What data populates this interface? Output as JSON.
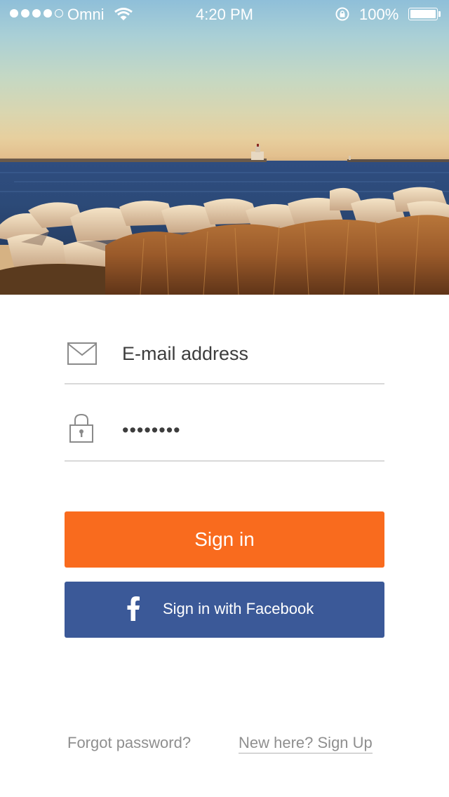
{
  "status_bar": {
    "carrier": "Omni",
    "time": "4:20 PM",
    "battery_percent": "100%",
    "signal_bars_filled": 4,
    "signal_bars_total": 5,
    "battery_level": 1.0
  },
  "hero": {
    "image_name": "lakeshore-lighthouse-photo"
  },
  "login_form": {
    "email_placeholder": "E-mail address",
    "password_value": "••••••••",
    "email_icon": "envelope-icon",
    "password_icon": "lock-icon"
  },
  "buttons": {
    "sign_in": "Sign in",
    "facebook": "Sign in with Facebook",
    "facebook_icon": "facebook-f-icon"
  },
  "links": {
    "forgot_password": "Forgot password?",
    "sign_up": "New here? Sign Up"
  },
  "colors": {
    "primary": "#f96b1e",
    "facebook": "#3b5998",
    "divider": "#d9d9d9",
    "link": "#8f8f8f"
  }
}
